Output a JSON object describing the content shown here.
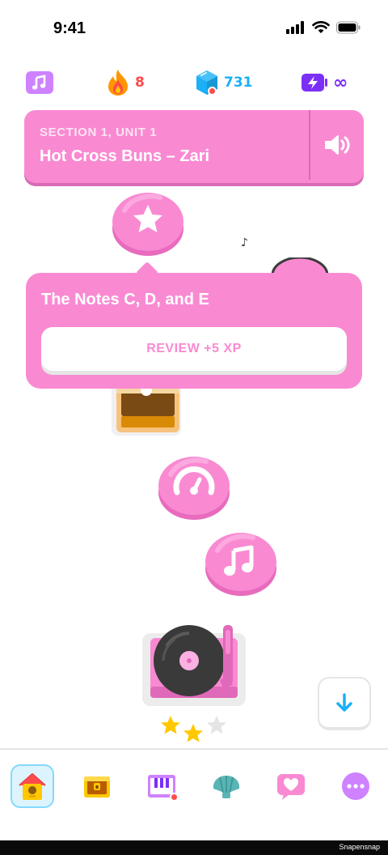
{
  "status_bar": {
    "time": "9:41"
  },
  "stats": {
    "course_icon": "music-note-icon",
    "streak": "8",
    "gems": "731",
    "energy": "∞",
    "colors": {
      "streak": "#ff4b4b",
      "gems": "#1cb0f6",
      "energy": "#7b2ff7"
    }
  },
  "unit": {
    "section": "SECTION 1, UNIT 1",
    "title": "Hot Cross Buns – Zari",
    "color": "#f98ad2"
  },
  "popup": {
    "title": "The Notes C, D, and E",
    "button": "REVIEW +5 XP"
  },
  "path_nodes": [
    {
      "icon": "star-icon",
      "state": "completed"
    },
    {
      "icon": "treasure-chest-icon",
      "state": "opened"
    },
    {
      "icon": "speedometer-icon",
      "state": "completed"
    },
    {
      "icon": "music-note-icon",
      "state": "completed"
    },
    {
      "icon": "record-player-icon",
      "state": "completed",
      "stars_earned": 2,
      "stars_total": 3
    }
  ],
  "bottom_nav": [
    {
      "icon": "home-icon",
      "active": true
    },
    {
      "icon": "treasure-chest-icon",
      "active": false
    },
    {
      "icon": "piano-icon",
      "active": false
    },
    {
      "icon": "shell-icon",
      "active": false
    },
    {
      "icon": "heart-message-icon",
      "active": false
    },
    {
      "icon": "more-icon",
      "active": false
    }
  ],
  "footer": {
    "watermark": "Snapensnap"
  }
}
